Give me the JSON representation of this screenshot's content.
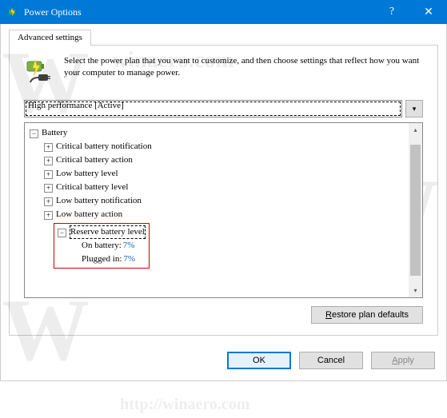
{
  "background": {
    "watermark_text_top": "winaero.com",
    "watermark_w": "W",
    "watermark_url": "http://winaero.com",
    "watermark_text_bottom": "http://winaero.com"
  },
  "window": {
    "title": "Power Options",
    "help_label": "?",
    "close_label": "✕"
  },
  "tabs": {
    "advanced": "Advanced settings"
  },
  "intro": {
    "text": "Select the power plan that you want to customize, and then choose settings that reflect how you want your computer to manage power."
  },
  "plan": {
    "selected": "High performance [Active]"
  },
  "tree": {
    "root": "Battery",
    "items": [
      "Critical battery notification",
      "Critical battery action",
      "Low battery level",
      "Critical battery level",
      "Low battery notification",
      "Low battery action"
    ],
    "reserve": {
      "title": "Reserve battery level",
      "on_battery_label": "On battery:",
      "on_battery_value": "7%",
      "plugged_in_label": "Plugged in:",
      "plugged_in_value": "7%"
    }
  },
  "buttons": {
    "restore": "Restore plan defaults",
    "ok": "OK",
    "cancel": "Cancel",
    "apply": "Apply"
  }
}
